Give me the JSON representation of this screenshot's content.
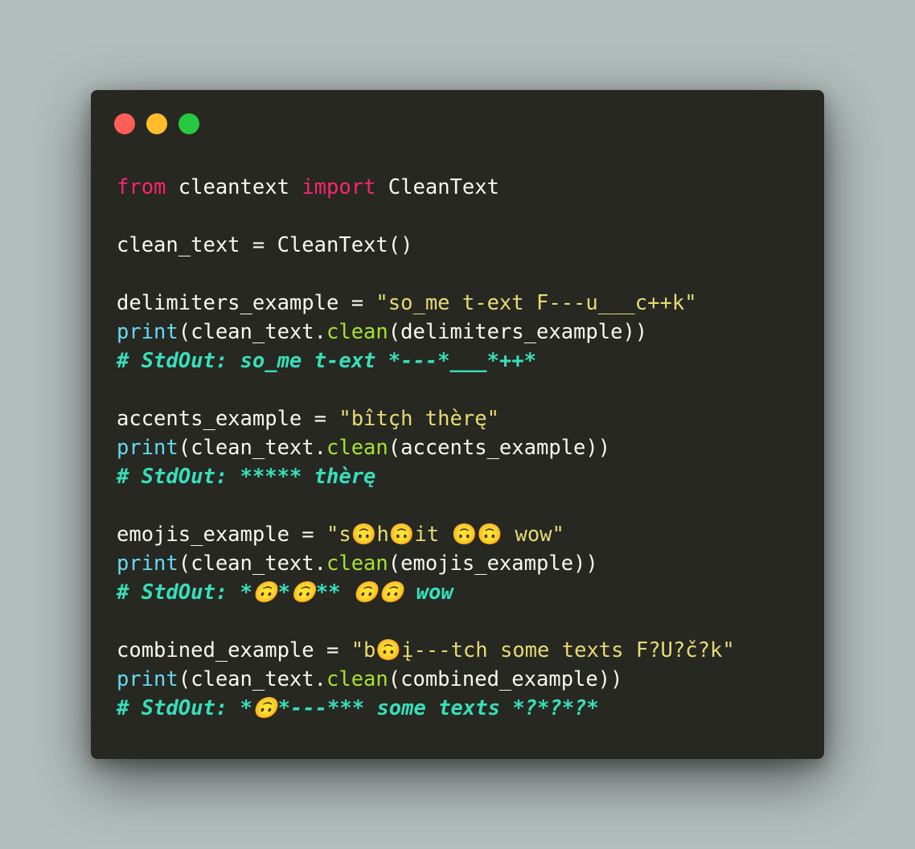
{
  "window": {
    "traffic_lights": {
      "close_color": "#ff5f56",
      "minimize_color": "#ffbd2e",
      "maximize_color": "#27c93f"
    }
  },
  "colors": {
    "background": "#b2bdbc",
    "editor_bg": "#272822",
    "keyword": "#f92672",
    "builtin": "#66d9ef",
    "function": "#a6e22e",
    "string": "#e6db74",
    "comment": "#37dfba",
    "text": "#f8f8f2"
  },
  "code": {
    "lines": [
      [
        {
          "type": "keyword",
          "text": "from"
        },
        {
          "type": "plain",
          "text": " cleantext "
        },
        {
          "type": "keyword",
          "text": "import"
        },
        {
          "type": "plain",
          "text": " CleanText"
        }
      ],
      [],
      [
        {
          "type": "plain",
          "text": "clean_text = CleanText()"
        }
      ],
      [],
      [
        {
          "type": "plain",
          "text": "delimiters_example = "
        },
        {
          "type": "string",
          "text": "\"so_me t-ext F---u___c++k\""
        }
      ],
      [
        {
          "type": "builtin",
          "text": "print"
        },
        {
          "type": "plain",
          "text": "(clean_text."
        },
        {
          "type": "func",
          "text": "clean"
        },
        {
          "type": "plain",
          "text": "(delimiters_example))"
        }
      ],
      [
        {
          "type": "comment",
          "text": "# StdOut: so_me t-ext *---*___*++*"
        }
      ],
      [],
      [
        {
          "type": "plain",
          "text": "accents_example = "
        },
        {
          "type": "string",
          "text": "\"bîtçh thèrę\""
        }
      ],
      [
        {
          "type": "builtin",
          "text": "print"
        },
        {
          "type": "plain",
          "text": "(clean_text."
        },
        {
          "type": "func",
          "text": "clean"
        },
        {
          "type": "plain",
          "text": "(accents_example))"
        }
      ],
      [
        {
          "type": "comment",
          "text": "# StdOut: ***** thèrę"
        }
      ],
      [],
      [
        {
          "type": "plain",
          "text": "emojis_example = "
        },
        {
          "type": "string",
          "text": "\"s🙃h🙃it 🙃🙃 wow\""
        }
      ],
      [
        {
          "type": "builtin",
          "text": "print"
        },
        {
          "type": "plain",
          "text": "(clean_text."
        },
        {
          "type": "func",
          "text": "clean"
        },
        {
          "type": "plain",
          "text": "(emojis_example))"
        }
      ],
      [
        {
          "type": "comment",
          "text": "# StdOut: *🙃*🙃** 🙃🙃 wow"
        }
      ],
      [],
      [
        {
          "type": "plain",
          "text": "combined_example = "
        },
        {
          "type": "string",
          "text": "\"b🙃į---tch some texts F?U?č?k\""
        }
      ],
      [
        {
          "type": "builtin",
          "text": "print"
        },
        {
          "type": "plain",
          "text": "(clean_text."
        },
        {
          "type": "func",
          "text": "clean"
        },
        {
          "type": "plain",
          "text": "(combined_example))"
        }
      ],
      [
        {
          "type": "comment",
          "text": "# StdOut: *🙃*---*** some texts *?*?*?*"
        }
      ]
    ]
  }
}
